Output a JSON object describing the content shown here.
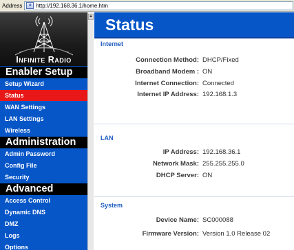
{
  "browser": {
    "address_label": "Address",
    "url": "http://192.168.36.1/home.htm"
  },
  "sidebar": {
    "brand": "Infinite Radio",
    "sections": [
      {
        "title": "Enabler Setup",
        "items": [
          {
            "label": "Setup Wizard",
            "active": false
          },
          {
            "label": "Status",
            "active": true
          },
          {
            "label": "WAN Settings",
            "active": false
          },
          {
            "label": "LAN Settings",
            "active": false
          },
          {
            "label": "Wireless",
            "active": false
          }
        ]
      },
      {
        "title": "Administration",
        "items": [
          {
            "label": "Admin Password",
            "active": false
          },
          {
            "label": "Config File",
            "active": false
          },
          {
            "label": "Security",
            "active": false
          }
        ]
      },
      {
        "title": "Advanced",
        "items": [
          {
            "label": "Access Control",
            "active": false
          },
          {
            "label": "Dynamic DNS",
            "active": false
          },
          {
            "label": "DMZ",
            "active": false
          },
          {
            "label": "Logs",
            "active": false
          },
          {
            "label": "Options",
            "active": false
          }
        ]
      }
    ]
  },
  "page": {
    "title": "Status",
    "internet": {
      "heading": "Internet",
      "rows": [
        {
          "label": "Connection Method:",
          "value": "DHCP/Fixed"
        },
        {
          "label": "Broadband Modem :",
          "value": "ON"
        },
        {
          "label": "Internet Connection:",
          "value": "Connected"
        },
        {
          "label": "Internet IP Address:",
          "value": "192.168.1.3"
        }
      ]
    },
    "lan": {
      "heading": "LAN",
      "rows": [
        {
          "label": "IP Address:",
          "value": "192.168.36.1"
        },
        {
          "label": "Network Mask:",
          "value": "255.255.255.0"
        },
        {
          "label": "DHCP Server:",
          "value": "ON"
        }
      ]
    },
    "system": {
      "heading": "System",
      "rows": [
        {
          "label": "Device Name:",
          "value": "SC000088"
        },
        {
          "label": "Firmware Version:",
          "value": "Version 1.0 Release 02"
        }
      ]
    }
  },
  "colors": {
    "sidebar_blue": "#0656c8",
    "active_red": "#e81818",
    "section_black": "#000000",
    "heading_blue": "#1c5bbf"
  }
}
